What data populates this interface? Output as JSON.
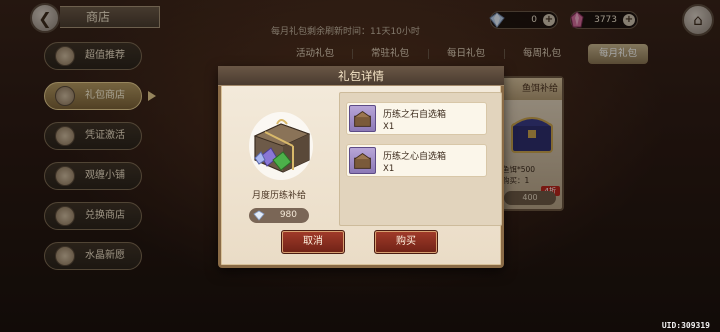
{
  "header": {
    "back_icon": "back-arrow-icon",
    "title": "商店",
    "home_icon": "home-icon",
    "refresh_note": "每月礼包剩余刷新时间：11天10小时"
  },
  "currencies": [
    {
      "icon": "diamond-icon",
      "value": "0"
    },
    {
      "icon": "pink-crystal-icon",
      "value": "3773"
    }
  ],
  "sidebar": {
    "items": [
      {
        "label": "超值推荐",
        "icon": "star-badge-icon",
        "active": false
      },
      {
        "label": "礼包商店",
        "icon": "gift-icon",
        "active": true
      },
      {
        "label": "凭证激活",
        "icon": "ticket-icon",
        "active": false
      },
      {
        "label": "观缠小铺",
        "icon": "shop-icon",
        "active": false
      },
      {
        "label": "兑换商店",
        "icon": "exchange-icon",
        "active": false
      },
      {
        "label": "水晶新愿",
        "icon": "crystal-icon",
        "active": false
      }
    ]
  },
  "tabs": [
    {
      "label": "活动礼包",
      "active": false
    },
    {
      "label": "常驻礼包",
      "active": false
    },
    {
      "label": "每日礼包",
      "active": false
    },
    {
      "label": "每周礼包",
      "active": false
    },
    {
      "label": "每月礼包",
      "active": true
    }
  ],
  "background_card": {
    "title": "鱼饵补给",
    "line1": "鱼饵*500",
    "line2": "购买：1",
    "badge": "4折",
    "price": "400"
  },
  "modal": {
    "title": "礼包详情",
    "pack_name": "月度历练补给",
    "pack_price": "980",
    "pack_icon": "treasure-chest-icon",
    "items": [
      {
        "name": "历练之石自选箱",
        "qty": "X1",
        "icon": "chest-icon"
      },
      {
        "name": "历练之心自选箱",
        "qty": "X1",
        "icon": "chest-icon"
      }
    ],
    "cancel_label": "取消",
    "buy_label": "购买"
  },
  "footer": {
    "uid": "UID:309319"
  }
}
